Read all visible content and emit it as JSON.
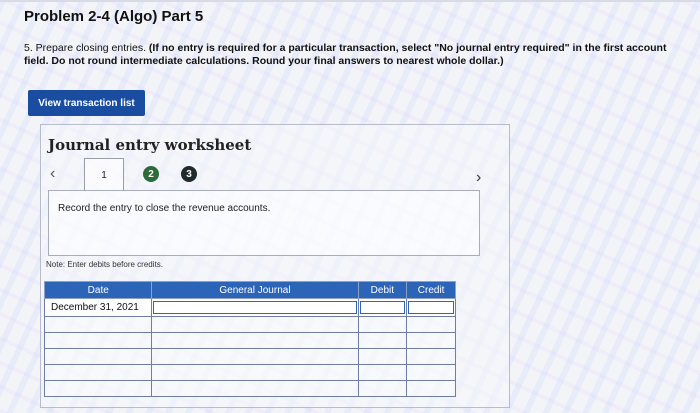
{
  "page": {
    "title": "Problem 2-4 (Algo) Part 5",
    "instructions_lead": "5. Prepare closing entries.",
    "instructions_bold": "(If no entry is required for a particular transaction, select \"No journal entry required\" in the first account field. Do not round intermediate calculations. Round your final answers to nearest whole dollar.)"
  },
  "view_transaction_button": "View transaction list",
  "worksheet": {
    "title": "Journal entry worksheet",
    "steps": [
      "1",
      "2",
      "3"
    ],
    "entry_prompt": "Record the entry to close the revenue accounts.",
    "note": "Note: Enter debits before credits.",
    "columns": [
      "Date",
      "General Journal",
      "Debit",
      "Credit"
    ],
    "rows": [
      {
        "date": "December 31, 2021",
        "account": "",
        "debit": "",
        "credit": ""
      },
      {
        "date": "",
        "account": "",
        "debit": "",
        "credit": ""
      },
      {
        "date": "",
        "account": "",
        "debit": "",
        "credit": ""
      },
      {
        "date": "",
        "account": "",
        "debit": "",
        "credit": ""
      },
      {
        "date": "",
        "account": "",
        "debit": "",
        "credit": ""
      },
      {
        "date": "",
        "account": "",
        "debit": "",
        "credit": ""
      }
    ]
  },
  "icons": {
    "prev": "chevron-left-icon",
    "next": "chevron-right-icon"
  },
  "colors": {
    "button": "#1a4da0",
    "table_header": "#2c64b8",
    "step2": "#2e6b3a",
    "step3": "#1f2a2a"
  }
}
